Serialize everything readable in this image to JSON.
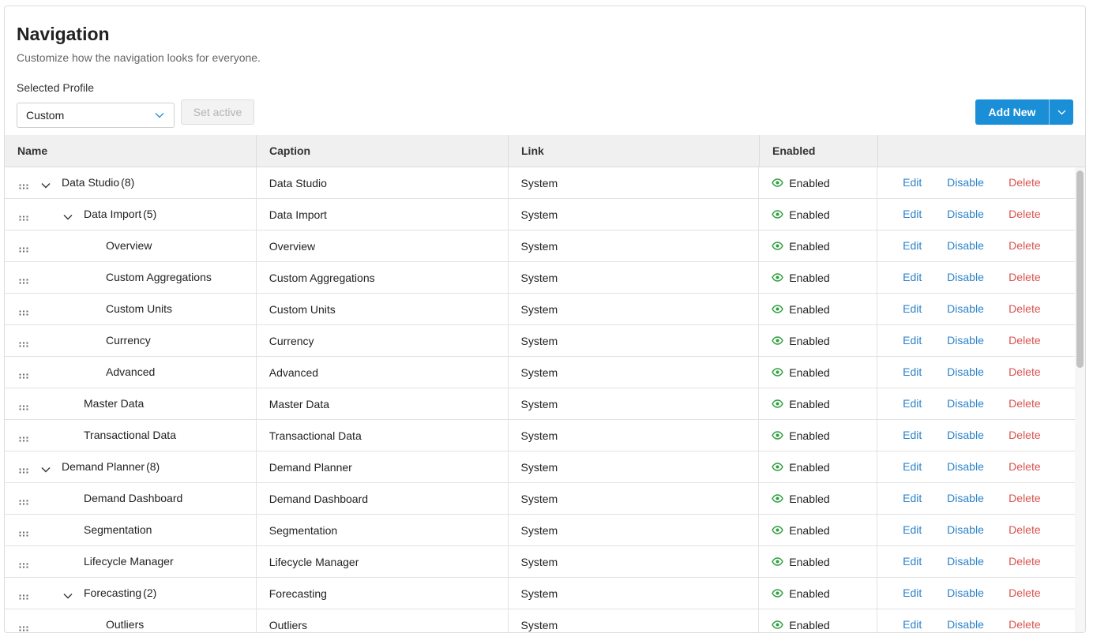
{
  "page": {
    "title": "Navigation",
    "subtitle": "Customize how the navigation looks for everyone."
  },
  "profile": {
    "label": "Selected Profile",
    "selected": "Custom",
    "set_active_label": "Set active"
  },
  "toolbar": {
    "add_new_label": "Add New"
  },
  "columns": {
    "name": "Name",
    "caption": "Caption",
    "link": "Link",
    "enabled": "Enabled"
  },
  "actions": {
    "edit": "Edit",
    "disable": "Disable",
    "delete": "Delete"
  },
  "colors": {
    "accent": "#1a8fd8",
    "link_blue": "#2c82c9",
    "delete_red": "#d9534f",
    "enabled_green": "#2e9e3e"
  },
  "rows": [
    {
      "name": "Data Studio",
      "count": "(8)",
      "level": 0,
      "expandable": true,
      "caption": "Data Studio",
      "link": "System",
      "enabled": "Enabled"
    },
    {
      "name": "Data Import",
      "count": "(5)",
      "level": 1,
      "expandable": true,
      "caption": "Data Import",
      "link": "System",
      "enabled": "Enabled"
    },
    {
      "name": "Overview",
      "count": "",
      "level": 2,
      "expandable": false,
      "caption": "Overview",
      "link": "System",
      "enabled": "Enabled"
    },
    {
      "name": "Custom Aggregations",
      "count": "",
      "level": 2,
      "expandable": false,
      "caption": "Custom Aggregations",
      "link": "System",
      "enabled": "Enabled"
    },
    {
      "name": "Custom Units",
      "count": "",
      "level": 2,
      "expandable": false,
      "caption": "Custom Units",
      "link": "System",
      "enabled": "Enabled"
    },
    {
      "name": "Currency",
      "count": "",
      "level": 2,
      "expandable": false,
      "caption": "Currency",
      "link": "System",
      "enabled": "Enabled"
    },
    {
      "name": "Advanced",
      "count": "",
      "level": 2,
      "expandable": false,
      "caption": "Advanced",
      "link": "System",
      "enabled": "Enabled"
    },
    {
      "name": "Master Data",
      "count": "",
      "level": 1,
      "expandable": false,
      "caption": "Master Data",
      "link": "System",
      "enabled": "Enabled"
    },
    {
      "name": "Transactional Data",
      "count": "",
      "level": 1,
      "expandable": false,
      "caption": "Transactional Data",
      "link": "System",
      "enabled": "Enabled"
    },
    {
      "name": "Demand Planner",
      "count": "(8)",
      "level": 0,
      "expandable": true,
      "caption": "Demand Planner",
      "link": "System",
      "enabled": "Enabled"
    },
    {
      "name": "Demand Dashboard",
      "count": "",
      "level": 1,
      "expandable": false,
      "caption": "Demand Dashboard",
      "link": "System",
      "enabled": "Enabled"
    },
    {
      "name": "Segmentation",
      "count": "",
      "level": 1,
      "expandable": false,
      "caption": "Segmentation",
      "link": "System",
      "enabled": "Enabled"
    },
    {
      "name": "Lifecycle Manager",
      "count": "",
      "level": 1,
      "expandable": false,
      "caption": "Lifecycle Manager",
      "link": "System",
      "enabled": "Enabled"
    },
    {
      "name": "Forecasting",
      "count": "(2)",
      "level": 1,
      "expandable": true,
      "caption": "Forecasting",
      "link": "System",
      "enabled": "Enabled"
    },
    {
      "name": "Outliers",
      "count": "",
      "level": 2,
      "expandable": false,
      "caption": "Outliers",
      "link": "System",
      "enabled": "Enabled"
    }
  ]
}
